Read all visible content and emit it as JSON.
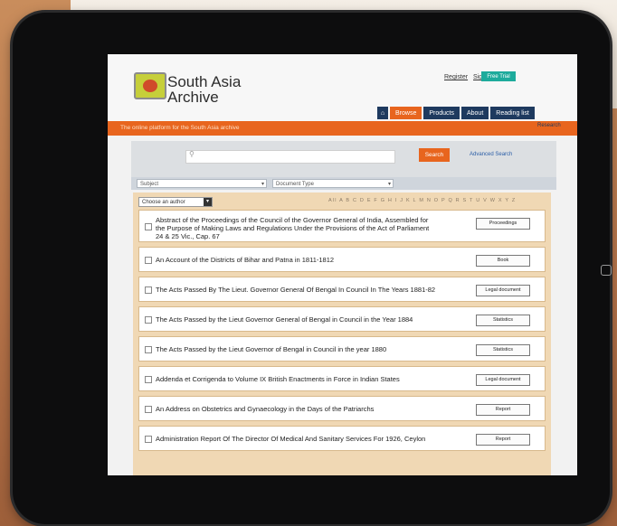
{
  "brand": {
    "line1": "South Asia",
    "line2": "Archive"
  },
  "top_links": {
    "register": "Register",
    "sign_in": "Sign in",
    "cta": "Free Trial"
  },
  "tabs": [
    {
      "label": "Browse",
      "active": true
    },
    {
      "label": "Products",
      "active": false
    },
    {
      "label": "About",
      "active": false
    },
    {
      "label": "Reading list",
      "active": false
    }
  ],
  "tagline": "The online platform for the South Asia archive",
  "bar_logo": "Research",
  "search": {
    "placeholder": "",
    "button": "Search",
    "advanced": "Advanced Search"
  },
  "filters": {
    "subject": "Subject",
    "document_type": "Document Type"
  },
  "author_select": "Choose an author",
  "alphabet": "All A B C D E F G H I J K L M N O P Q R S T U V W X Y Z",
  "items": [
    {
      "title": "Abstract of the Proceedings of the Council of the Governor General of India, Assembled for the Purpose of Making Laws and Regulations Under the Provisions of the Act of Parliament 24 & 25 Vic., Cap. 67",
      "type": "Proceedings"
    },
    {
      "title": "An Account of the Districts of Bihar and Patna in 1811-1812",
      "type": "Book"
    },
    {
      "title": "The Acts Passed By The Lieut. Governor General Of Bengal In Council In The Years 1881-82",
      "type": "Legal document"
    },
    {
      "title": "The Acts Passed by the Lieut Governor General of Bengal in Council in the Year 1884",
      "type": "Statistics"
    },
    {
      "title": "The Acts Passed by the Lieut Governor of Bengal in Council in the year 1880",
      "type": "Statistics"
    },
    {
      "title": "Addenda et Corrigenda to Volume IX British Enactments in Force in Indian States",
      "type": "Legal document"
    },
    {
      "title": "An Address on Obstetrics and Gynaecology in the Days of the Patriarchs",
      "type": "Report"
    },
    {
      "title": "Administration Report Of The Director Of Medical And Sanitary Services For 1926, Ceylon",
      "type": "Report"
    }
  ],
  "colors": {
    "accent": "#e8651e",
    "nav": "#1e3a5f",
    "cta": "#1dab9c",
    "list_bg": "#f0d8b4"
  }
}
